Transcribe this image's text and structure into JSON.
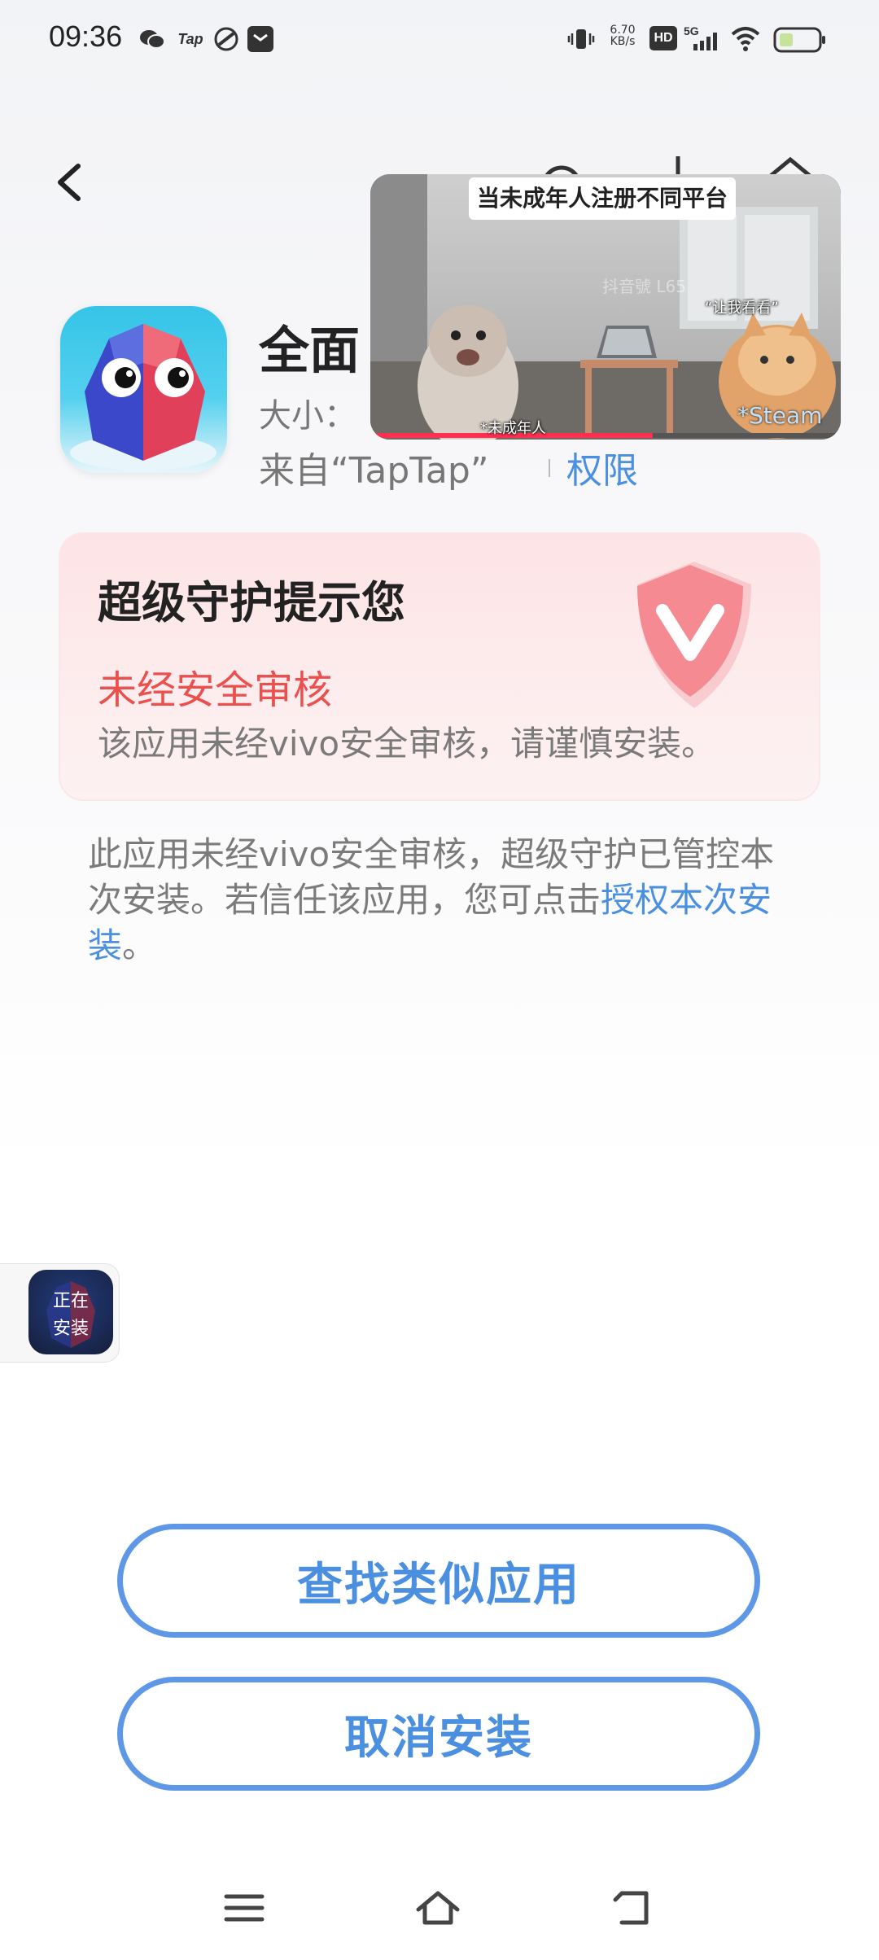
{
  "status_bar": {
    "time": "09:36",
    "notification_icons": [
      "wechat-icon",
      "taptap-icon",
      "app-icon",
      "mail-icon"
    ],
    "taptap_label": "Tap",
    "network_speed_value": "6.70",
    "network_speed_unit": "KB/s",
    "hd_label": "HD",
    "signal_label": "5G"
  },
  "header": {
    "back_icon": "chevron-left-icon"
  },
  "app": {
    "name": "全面",
    "size_label": "大小：",
    "source_label": "来自“TapTap”",
    "permission_link": "权限"
  },
  "warning_card": {
    "title": "超级守护提示您",
    "alert": "未经安全审核",
    "description": "该应用未经vivo安全审核，请谨慎安装。"
  },
  "notice": {
    "text": "此应用未经vivo安全审核，超级守护已管控本次安装。若信任该应用，您可点击",
    "link": "授权本次安装",
    "end": "。"
  },
  "installing_bubble": {
    "label_line1": "正在",
    "label_line2": "安装"
  },
  "buttons": {
    "find_similar": "查找类似应用",
    "cancel_install": "取消安装"
  },
  "video_overlay": {
    "title": "当未成年人注册不同平台",
    "watermark": "抖音號 L65",
    "caption_left": "*未成年人",
    "caption_right": "“让我看看”",
    "caption_steam": "*Steam",
    "progress_fraction": 0.6
  },
  "nav_bar": {
    "items": [
      "menu-icon",
      "home-icon",
      "back-icon"
    ]
  },
  "colors": {
    "accent": "#4a8fe0",
    "alert": "#e9504e",
    "card_bg": "#fde3e5"
  }
}
